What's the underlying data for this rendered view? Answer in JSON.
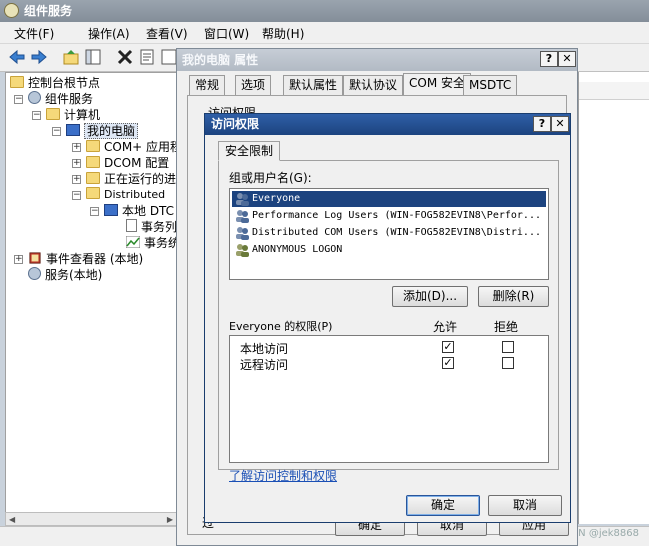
{
  "main_window": {
    "title": "组件服务",
    "menu": [
      "文件(F)",
      "操作(A)",
      "查看(V)",
      "窗口(W)",
      "帮助(H)"
    ]
  },
  "tree": {
    "items": [
      {
        "label": "控制台根节点",
        "icon": "folder-icon"
      },
      {
        "label": "组件服务",
        "icon": "gear-icon"
      },
      {
        "label": "计算机",
        "icon": "folder-icon"
      },
      {
        "label": "我的电脑",
        "icon": "computer-icon"
      },
      {
        "label": "COM+ 应用程序",
        "icon": "folder-icon"
      },
      {
        "label": "DCOM 配置",
        "icon": "folder-icon"
      },
      {
        "label": "正在运行的进",
        "icon": "folder-icon"
      },
      {
        "label": "Distributed",
        "icon": "folder-icon"
      },
      {
        "label": "本地 DTC",
        "icon": "computer-icon"
      },
      {
        "label": "事务列",
        "icon": "document-icon"
      },
      {
        "label": "事务统",
        "icon": "chart-icon"
      },
      {
        "label": "事件查看器 (本地)",
        "icon": "event-viewer-icon"
      },
      {
        "label": "服务(本地)",
        "icon": "gear-icon"
      }
    ]
  },
  "properties_dialog": {
    "title": "我的电脑 属性",
    "help_btn": "?",
    "close_btn": "✕",
    "tabs": [
      "常规",
      "选项",
      "默认属性",
      "默认协议",
      "COM 安全",
      "MSDTC"
    ],
    "group_label": "访问权限",
    "fragment_left": "过",
    "buttons": [
      "确定",
      "取消",
      "应用"
    ]
  },
  "access_dialog": {
    "title": "访问权限",
    "help_btn": "?",
    "close_btn": "✕",
    "tab": "安全限制",
    "group_users_label": "组或用户名(G):",
    "users": [
      {
        "name": "Everyone",
        "selected": true
      },
      {
        "name": "Performance Log Users (WIN-FOG582EVIN8\\Perfor...",
        "selected": false
      },
      {
        "name": "Distributed COM Users (WIN-FOG582EVIN8\\Distri...",
        "selected": false
      },
      {
        "name": "ANONYMOUS LOGON",
        "selected": false
      }
    ],
    "add_btn": "添加(D)...",
    "remove_btn": "删除(R)",
    "perm_label": "Everyone 的权限(P)",
    "allow_label": "允许",
    "deny_label": "拒绝",
    "permissions": [
      {
        "name": "本地访问",
        "allow": true,
        "deny": false
      },
      {
        "name": "远程访问",
        "allow": true,
        "deny": false
      }
    ],
    "link": "了解访问控制和权限",
    "ok_btn": "确定",
    "cancel_btn": "取消"
  },
  "watermark": "CSDN @jek8868",
  "colors": {
    "selection": "#1c437f",
    "active_title": "#2f5fa7",
    "inactive_title": "#b2bac4",
    "link": "#1a4fb5"
  }
}
